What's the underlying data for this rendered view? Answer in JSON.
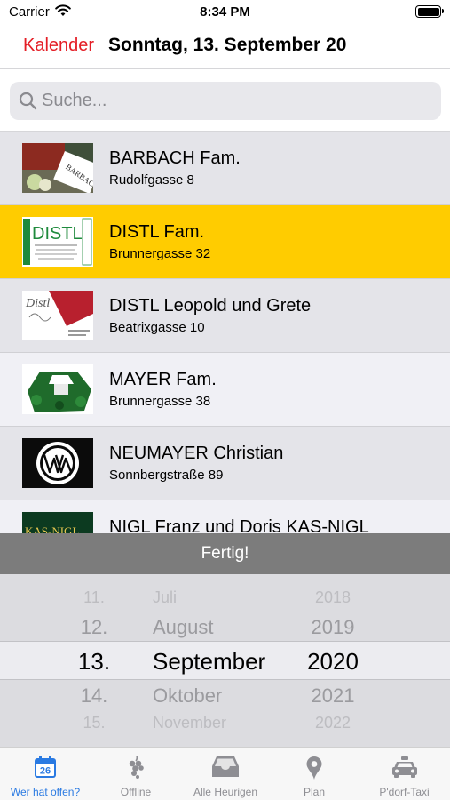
{
  "status_bar": {
    "carrier": "Carrier",
    "time": "8:34 PM"
  },
  "nav": {
    "back_label": "Kalender",
    "title": "Sonntag, 13. September 20"
  },
  "search": {
    "placeholder": "Suche...",
    "value": ""
  },
  "list": {
    "selected_index": 1,
    "items": [
      {
        "name": "BARBACH Fam.",
        "address": "Rudolfgasse 8"
      },
      {
        "name": "DISTL Fam.",
        "address": "Brunnergasse 32"
      },
      {
        "name": "DISTL Leopold und Grete",
        "address": "Beatrixgasse 10"
      },
      {
        "name": "MAYER Fam.",
        "address": "Brunnergasse 38"
      },
      {
        "name": "NEUMAYER Christian",
        "address": "Sonnbergstraße 89"
      },
      {
        "name": "NIGL Franz und Doris KAS-NIGL",
        "address": ""
      }
    ]
  },
  "logos": {
    "barbach": "BARBACH",
    "distl": "DISTL",
    "distl_script": "Distl",
    "kasnigl": "KAS-NIGL"
  },
  "picker": {
    "done_label": "Fertig!",
    "days": [
      "11.",
      "12.",
      "13.",
      "14.",
      "15."
    ],
    "months": [
      "Juli",
      "August",
      "September",
      "Oktober",
      "November"
    ],
    "years": [
      "2018",
      "2019",
      "2020",
      "2021",
      "2022"
    ],
    "selected": {
      "day": "13.",
      "month": "September",
      "year": "2020"
    }
  },
  "tabs": [
    {
      "label": "Wer hat offen?",
      "icon": "calendar-icon",
      "active": true,
      "badge": "26"
    },
    {
      "label": "Offline",
      "icon": "grapes-icon",
      "active": false
    },
    {
      "label": "Alle Heurigen",
      "icon": "inbox-icon",
      "active": false
    },
    {
      "label": "Plan",
      "icon": "map-pin-icon",
      "active": false
    },
    {
      "label": "P'dorf-Taxi",
      "icon": "taxi-icon",
      "active": false
    }
  ],
  "colors": {
    "accent_red": "#e41e26",
    "selected_row": "#ffcc00",
    "tab_active": "#2a7ae2",
    "tab_inactive": "#8e8e93",
    "done_bar": "#7c7c7c"
  }
}
